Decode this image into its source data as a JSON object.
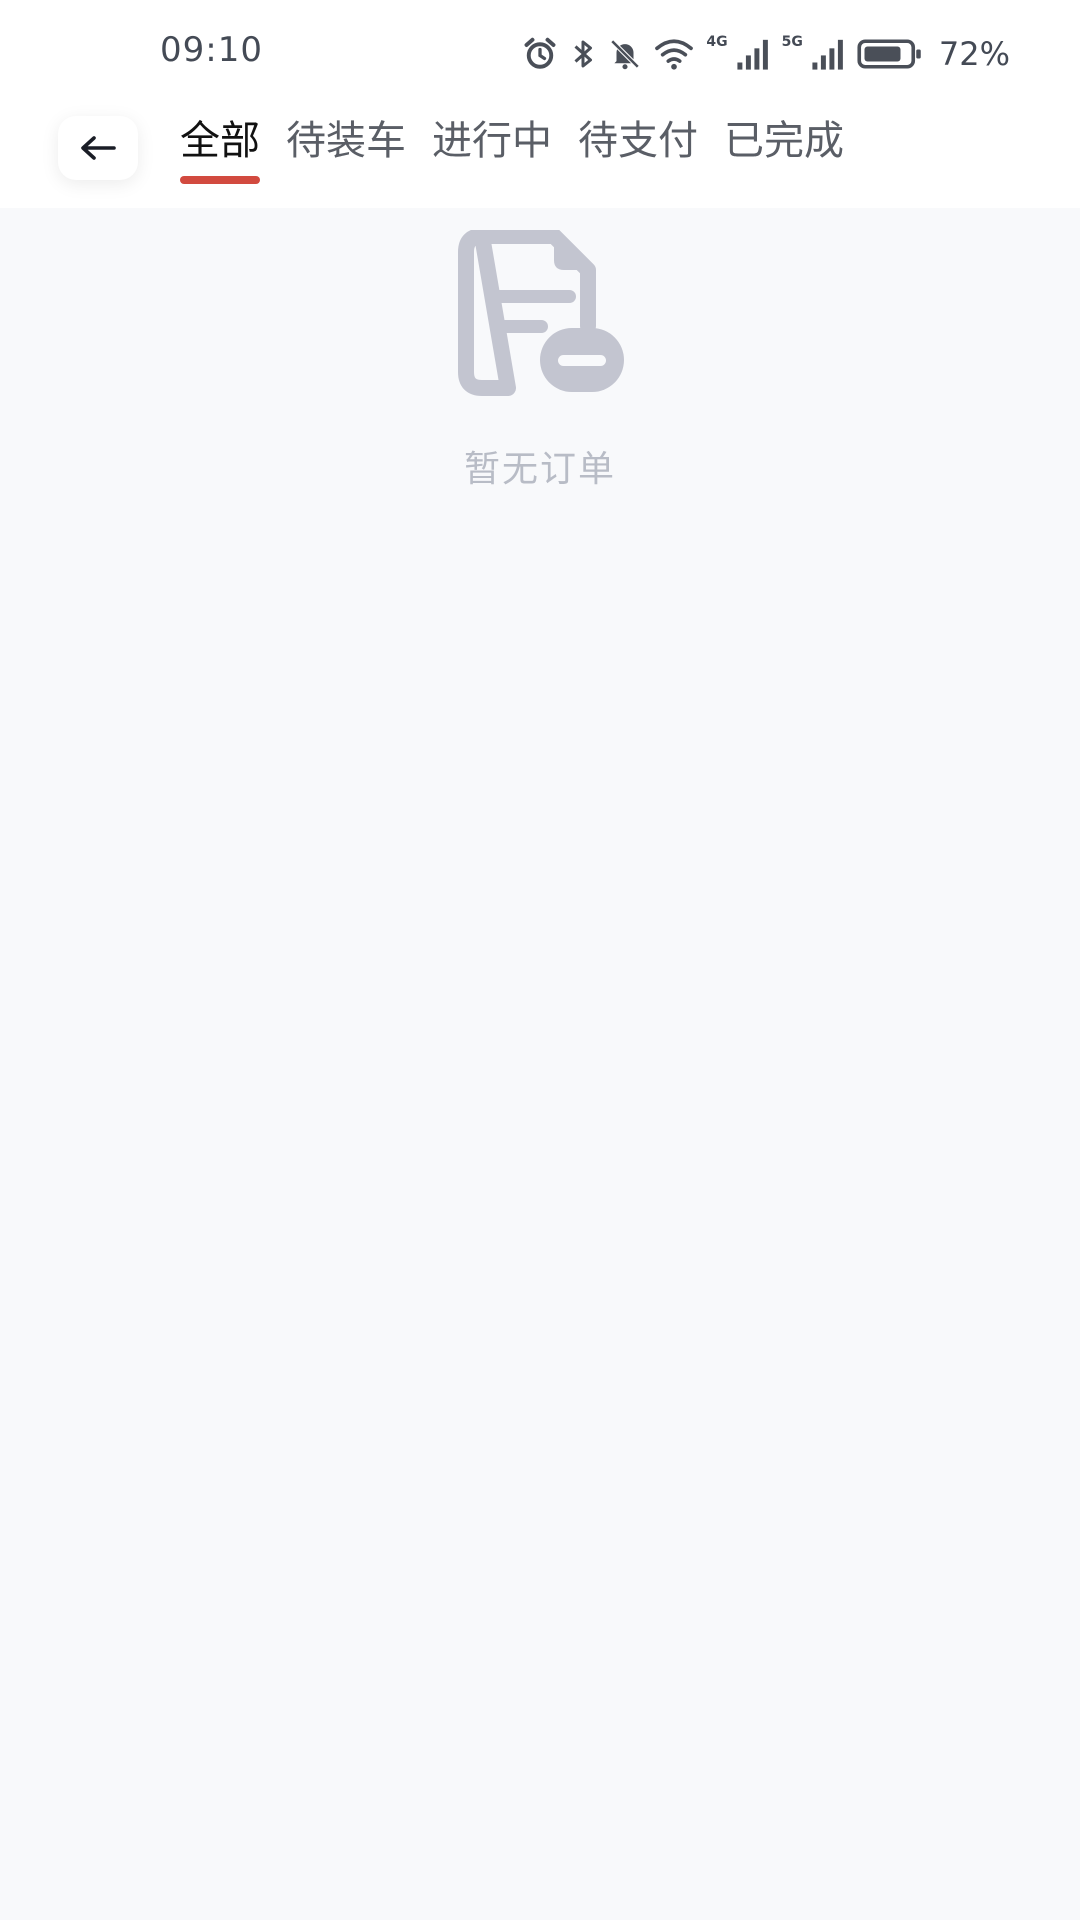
{
  "status_bar": {
    "time": "09:10",
    "net1": "4G",
    "net2": "5G",
    "battery": "72%",
    "icons": [
      "alarm-icon",
      "bluetooth-icon",
      "mute-icon",
      "wifi-icon",
      "signal-icon",
      "battery-icon"
    ]
  },
  "header": {
    "back_icon": "arrow-left-icon",
    "tabs": [
      {
        "label": "全部",
        "active": true
      },
      {
        "label": "待装车",
        "active": false
      },
      {
        "label": "进行中",
        "active": false
      },
      {
        "label": "待支付",
        "active": false
      },
      {
        "label": "已完成",
        "active": false
      }
    ],
    "accent_color": "#d24a3f"
  },
  "empty_state": {
    "icon": "empty-document-icon",
    "message": "暂无订单"
  }
}
